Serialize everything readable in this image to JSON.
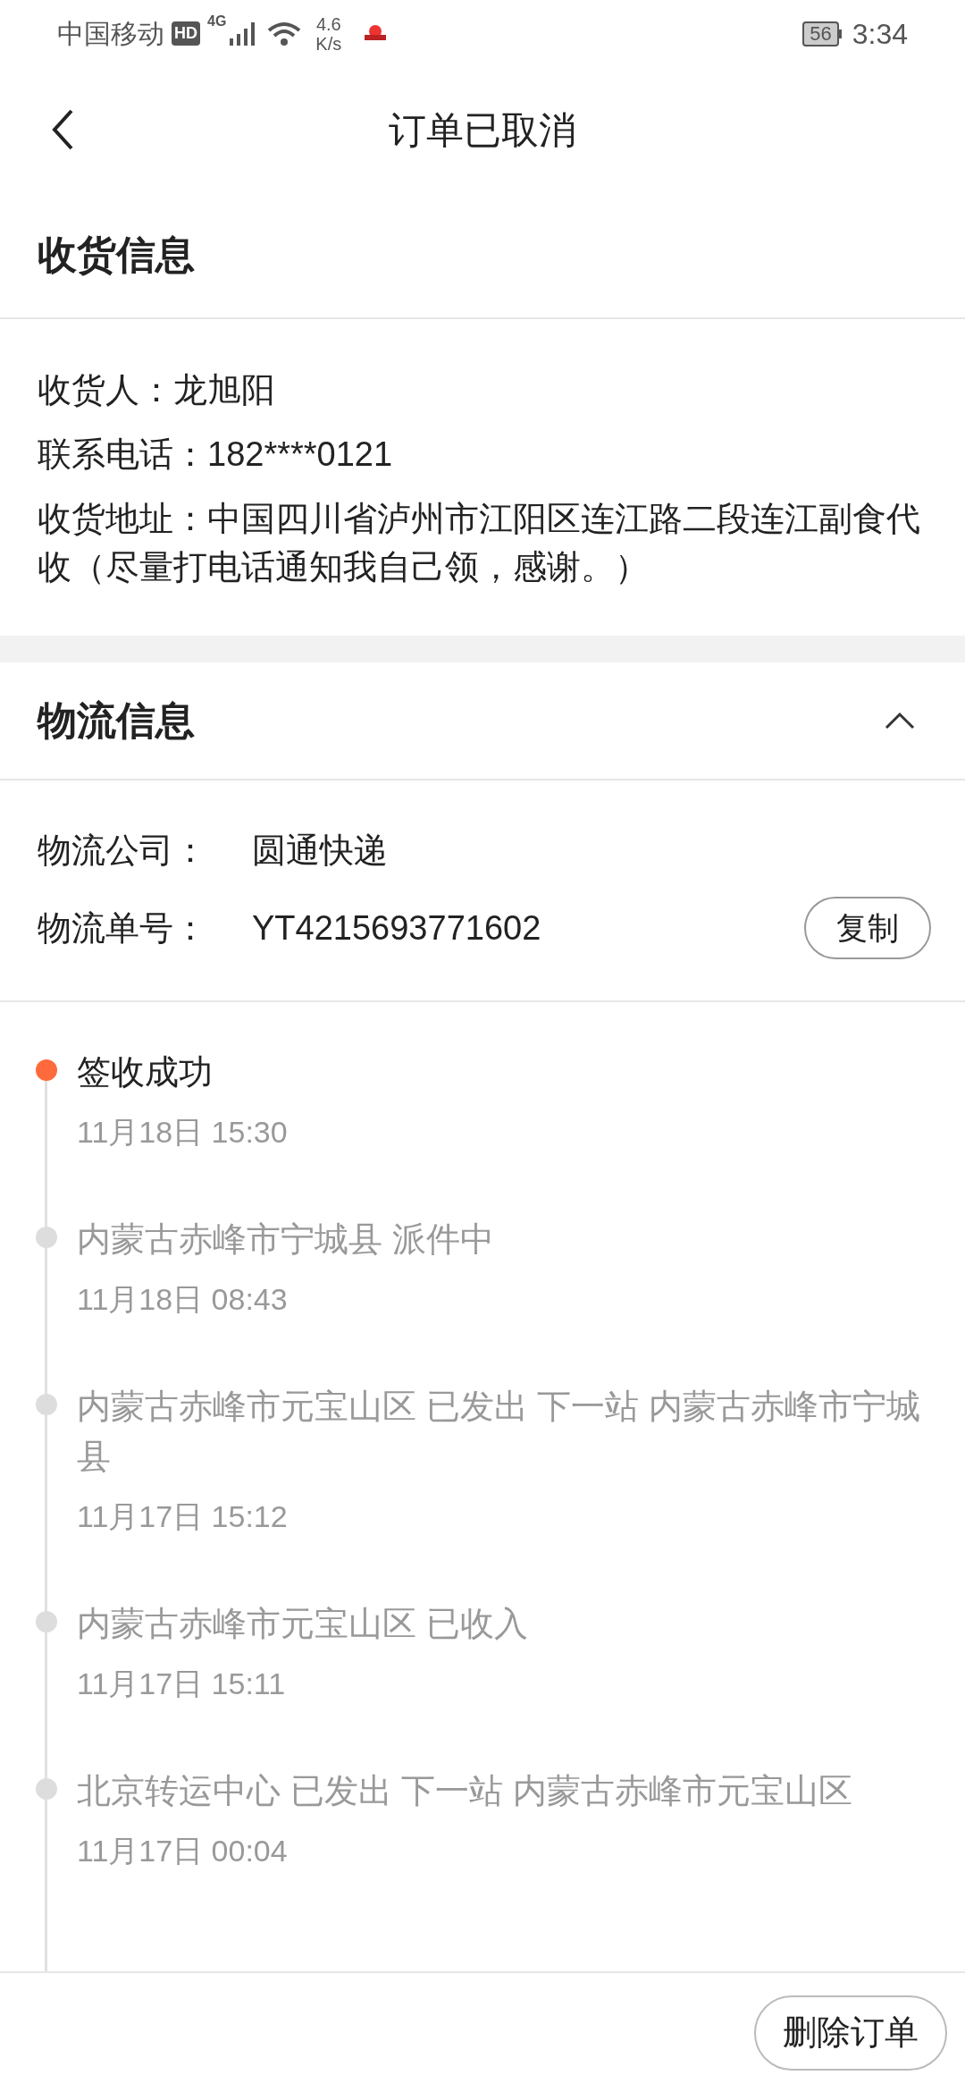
{
  "status_bar": {
    "carrier": "中国移动",
    "hd": "HD",
    "network": "4G",
    "speed_value": "4.6",
    "speed_unit": "K/s",
    "battery": "56",
    "time": "3:34"
  },
  "header": {
    "title": "订单已取消"
  },
  "receiver": {
    "title": "收货信息",
    "lines": [
      "收货人：龙旭阳",
      "联系电话：182****0121",
      "收货地址：中国四川省泸州市江阳区连江路二段连江副食代收（尽量打电话通知我自己领，感谢。）"
    ]
  },
  "logistics": {
    "title": "物流信息",
    "expanded": true,
    "company_label": "物流公司：",
    "company": "圆通快递",
    "number_label": "物流单号：",
    "number": "YT4215693771602",
    "copy_button": "复制"
  },
  "timeline": [
    {
      "text": "签收成功",
      "time": "11月18日 15:30",
      "selected": true
    },
    {
      "text": "内蒙古赤峰市宁城县 派件中",
      "time": "11月18日 08:43",
      "selected": false
    },
    {
      "text": "内蒙古赤峰市元宝山区 已发出 下一站  内蒙古赤峰市宁城县",
      "time": "11月17日 15:12",
      "selected": false
    },
    {
      "text": "内蒙古赤峰市元宝山区 已收入",
      "time": "11月17日 15:11",
      "selected": false
    },
    {
      "text": "北京转运中心 已发出 下一站  内蒙古赤峰市元宝山区",
      "time": "11月17日 00:04",
      "selected": false
    }
  ],
  "bottom_bar": {
    "delete_button": "删除订单"
  }
}
